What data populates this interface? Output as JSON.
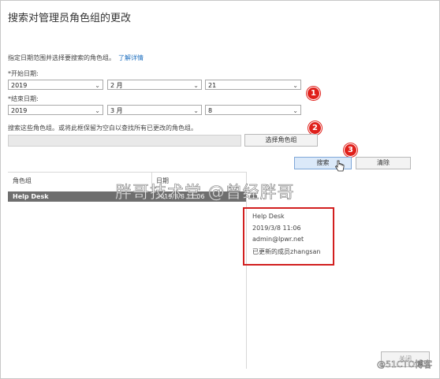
{
  "title": "搜索对管理员角色组的更改",
  "description": "指定日期范围并选择要搜索的角色组。",
  "learn_more": "了解详情",
  "start_label": "*开始日期:",
  "start": {
    "year": "2019",
    "month": "2 月",
    "day": "21"
  },
  "end_label": "*结束日期:",
  "end": {
    "year": "2019",
    "month": "3 月",
    "day": "8"
  },
  "search_hint": "搜索这些角色组。或将此框保留为空白以查找所有已更改的角色组。",
  "select_groups_button": "选择角色组",
  "search_button": "搜索",
  "clear_button": "清除",
  "table": {
    "col_role": "角色组",
    "col_date": "日期",
    "rows": [
      {
        "role": "Help Desk",
        "date": "2019/3/8 11:06"
      }
    ]
  },
  "detail": {
    "name": "Help Desk",
    "date": "2019/3/8 11:06",
    "user": "admin@lpwr.net",
    "change": "已更新的成员zhangsan"
  },
  "badges": [
    "1",
    "2",
    "3"
  ],
  "watermark": "胖哥技术堂 @曾经胖哥",
  "corner_button": "关闭",
  "corner_watermark": "@51CTO博客",
  "colors": {
    "accent": "#1e6fbf",
    "badge": "#e0201b",
    "selected_row": "#6e6e6e",
    "highlight_box": "#d21f1f"
  }
}
